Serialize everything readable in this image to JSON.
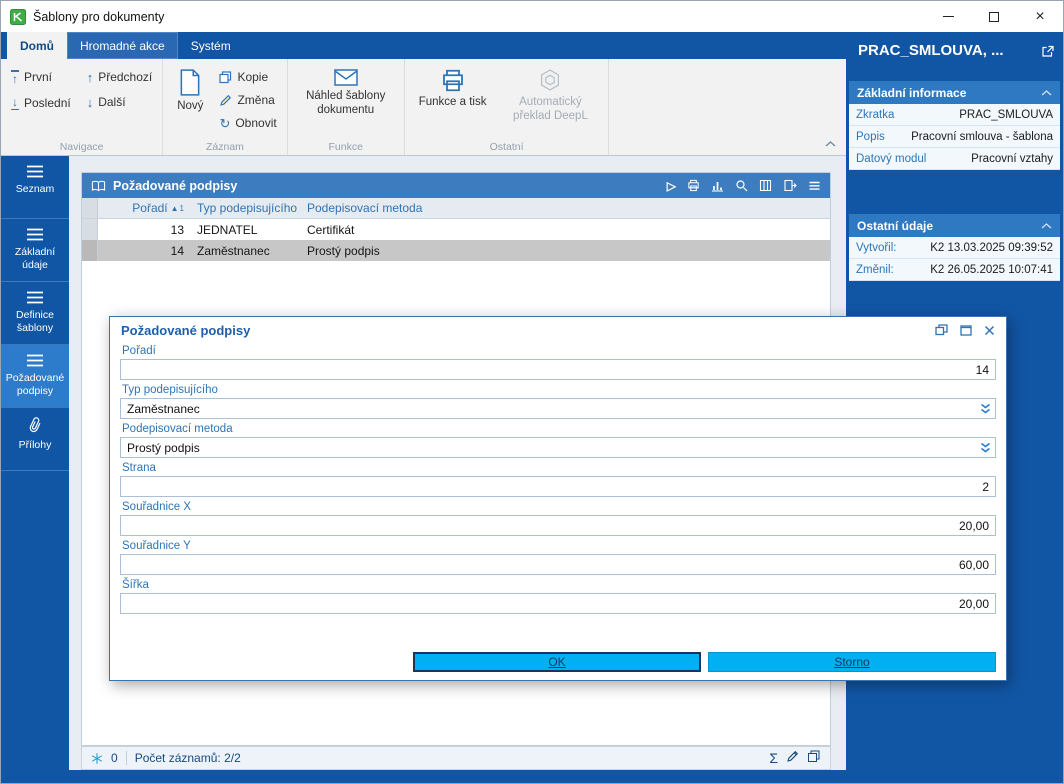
{
  "window": {
    "title": "Šablony pro dokumenty"
  },
  "icons": {
    "up": "↑",
    "down": "↓",
    "refresh": "↻",
    "sigma": "Σ",
    "sort_asc": "▲",
    "sort_order": "1",
    "play": "▷",
    "close": "×"
  },
  "tabs": [
    {
      "label": "Domů"
    },
    {
      "label": "Hromadné akce"
    },
    {
      "label": "Systém"
    }
  ],
  "ribbon": {
    "groups": {
      "navigace": {
        "label": "Navigace",
        "prvni": "První",
        "posledni": "Poslední",
        "predchozi": "Předchozí",
        "dalsi": "Další"
      },
      "zaznam": {
        "label": "Záznam",
        "novy": "Nový",
        "kopie": "Kopie",
        "zmena": "Změna",
        "obnovit": "Obnovit"
      },
      "funkce": {
        "label": "Funkce",
        "nahled": "Náhled šablony dokumentu"
      },
      "ostatni": {
        "label": "Ostatní",
        "funkce_tisk": "Funkce a tisk",
        "preklad": "Automatický překlad DeepL"
      }
    }
  },
  "sidebar": {
    "items": [
      {
        "label": "Seznam"
      },
      {
        "label": "Základní údaje"
      },
      {
        "label": "Definice šablony"
      },
      {
        "label": "Požadované podpisy"
      },
      {
        "label": "Přílohy"
      }
    ]
  },
  "grid": {
    "title": "Požadované podpisy",
    "columns": [
      "Pořadí",
      "Typ podepisujícího",
      "Podepisovací metoda"
    ],
    "rows": [
      [
        "13",
        "JEDNATEL",
        "Certifikát"
      ],
      [
        "14",
        "Zaměstnanec",
        "Prostý podpis"
      ]
    ]
  },
  "dialog": {
    "title": "Požadované podpisy",
    "fields": {
      "poradi": {
        "label": "Pořadí",
        "value": "14"
      },
      "typ": {
        "label": "Typ podepisujícího",
        "value": "Zaměstnanec"
      },
      "metoda": {
        "label": "Podepisovací metoda",
        "value": "Prostý podpis"
      },
      "strana": {
        "label": "Strana",
        "value": "2"
      },
      "souradnice_x": {
        "label": "Souřadnice X",
        "value": "20,00"
      },
      "souradnice_y": {
        "label": "Souřadnice Y",
        "value": "60,00"
      },
      "sirka": {
        "label": "Šířka",
        "value": "20,00"
      }
    },
    "buttons": {
      "ok": "OK",
      "storno": "Storno"
    }
  },
  "panel": {
    "title": "PRAC_SMLOUVA, ...",
    "sections": [
      {
        "header": "Základní informace",
        "rows": [
          {
            "label": "Zkratka",
            "value": "PRAC_SMLOUVA"
          },
          {
            "label": "Popis",
            "value": "Pracovní smlouva - šablona"
          },
          {
            "label": "Datový modul",
            "value": "Pracovní vztahy"
          }
        ]
      },
      {
        "header": "Ostatní údaje",
        "rows": [
          {
            "label": "Vytvořil:",
            "value": "K2 13.03.2025 09:39:52"
          },
          {
            "label": "Změnil:",
            "value": "K2 26.05.2025 10:07:41"
          }
        ]
      }
    ]
  },
  "statusbar": {
    "badge": "0",
    "records": "Počet záznamů: 2/2"
  },
  "colors": {
    "dark_blue": "#1156a5",
    "accent_blue": "#2e74b5",
    "grid_header_blue": "#3d7cbe",
    "section_blue": "#2e79c2",
    "button_cyan": "#00b0f0",
    "selected_row_gray": "#c7c7c7",
    "app_icon_green": "#3fae49"
  }
}
